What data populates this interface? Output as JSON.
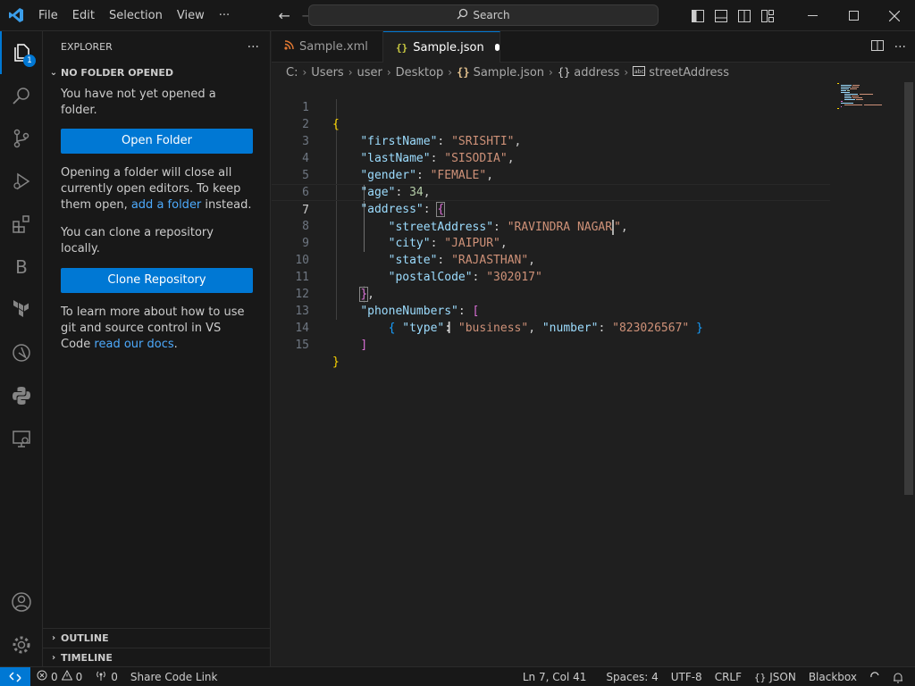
{
  "titlebar": {
    "menu": [
      "File",
      "Edit",
      "Selection",
      "View",
      "···"
    ],
    "search_label": "Search"
  },
  "activity": {
    "explorer_badge": "1"
  },
  "sidebar": {
    "title": "EXPLORER",
    "more": "···",
    "section": "NO FOLDER OPENED",
    "para1": "You have not yet opened a folder.",
    "open_folder": "Open Folder",
    "para2_a": "Opening a folder will close all currently open editors. To keep them open, ",
    "para2_link": "add a folder",
    "para2_b": " instead.",
    "para3": "You can clone a repository locally.",
    "clone_repo": "Clone Repository",
    "para4_a": "To learn more about how to use git and source control in VS Code ",
    "para4_link": "read our docs",
    "para4_b": ".",
    "outline": "OUTLINE",
    "timeline": "TIMELINE"
  },
  "tabs": [
    {
      "label": "Sample.xml",
      "icon": "rss-icon"
    },
    {
      "label": "Sample.json",
      "icon": "json-braces-icon",
      "dirty": true
    }
  ],
  "breadcrumb": [
    "C:",
    "Users",
    "user",
    "Desktop",
    "Sample.json",
    "address",
    "streetAddress"
  ],
  "editor": {
    "line_numbers": [
      "1",
      "2",
      "3",
      "4",
      "5",
      "6",
      "7",
      "8",
      "9",
      "10",
      "11",
      "12",
      "13",
      "14",
      "15"
    ],
    "current_line": 7,
    "tokens": {
      "firstName_k": "\"firstName\"",
      "firstName_v": "\"SRISHTI\"",
      "lastName_k": "\"lastName\"",
      "lastName_v": "\"SISODIA\"",
      "gender_k": "\"gender\"",
      "gender_v": "\"FEMALE\"",
      "age_k": "\"age\"",
      "age_v": "34",
      "address_k": "\"address\"",
      "street_k": "\"streetAddress\"",
      "street_v1": "\"RAVINDRA NAGAR",
      "street_v2": "\"",
      "city_k": "\"city\"",
      "city_v": "\"JAIPUR\"",
      "state_k": "\"state\"",
      "state_v": "\"RAJASTHAN\"",
      "postal_k": "\"postalCode\"",
      "postal_v": "\"302017\"",
      "phone_k": "\"phoneNumbers\"",
      "type_k": "\"type\"",
      "type_v": "\"business\"",
      "number_k": "\"number\"",
      "number_v": "\"823026567\""
    }
  },
  "statusbar": {
    "errors": "0",
    "warnings": "0",
    "ports": "0",
    "share": "Share Code Link",
    "position": "Ln 7, Col 41",
    "spaces": "Spaces: 4",
    "encoding": "UTF-8",
    "eol": "CRLF",
    "language": "JSON",
    "blackbox": "Blackbox"
  },
  "colors": {
    "accent": "#0078d4",
    "key": "#9cdcfe",
    "string": "#ce9178",
    "number": "#b5cea8",
    "bracket1": "#ffd700",
    "bracket2": "#da70d6",
    "bracket3": "#179fff"
  }
}
